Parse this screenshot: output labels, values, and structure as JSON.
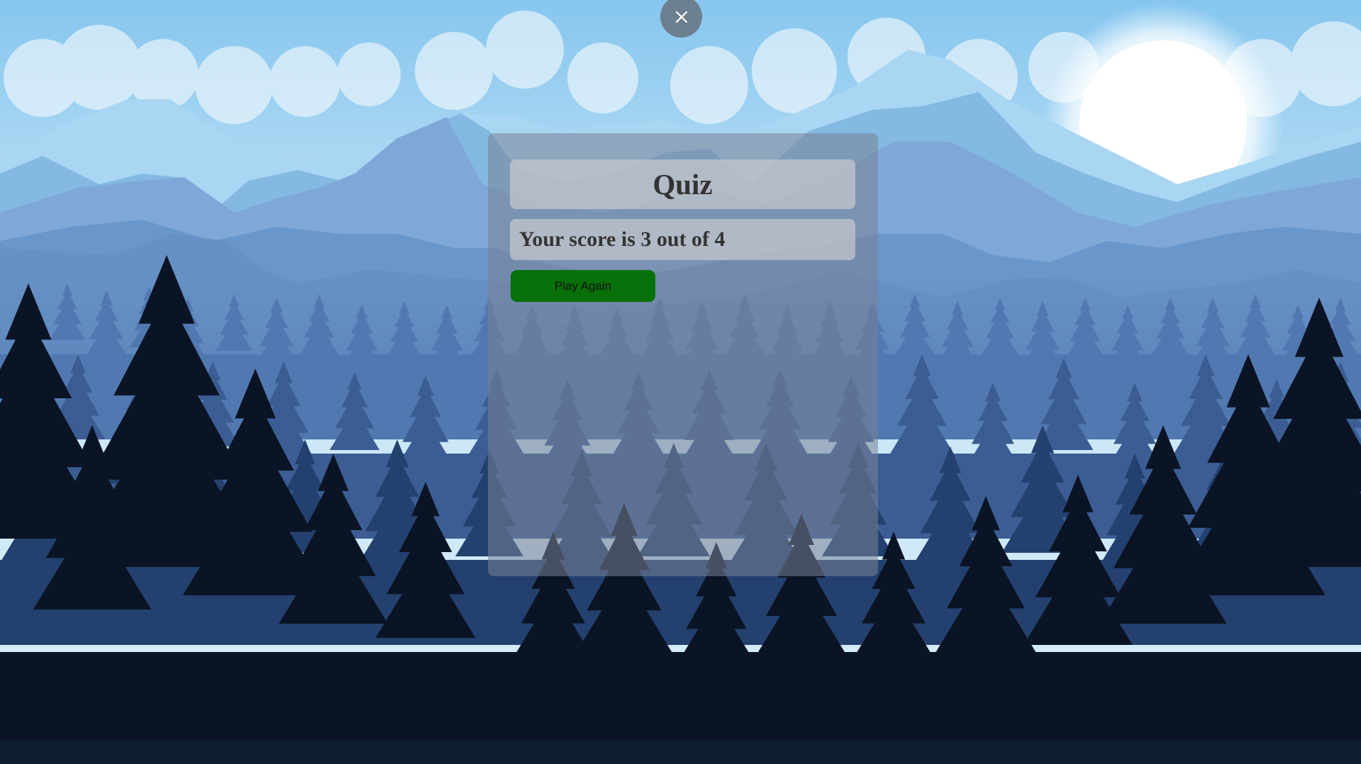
{
  "quiz": {
    "title": "Quiz",
    "score_text": "Your score is 3 out of 4",
    "play_again_label": "Play Again"
  },
  "icons": {
    "close": "close-icon"
  },
  "colors": {
    "play_button": "#087008",
    "sky_top": "#86c6ee",
    "forest_dark": "#0a1424"
  }
}
